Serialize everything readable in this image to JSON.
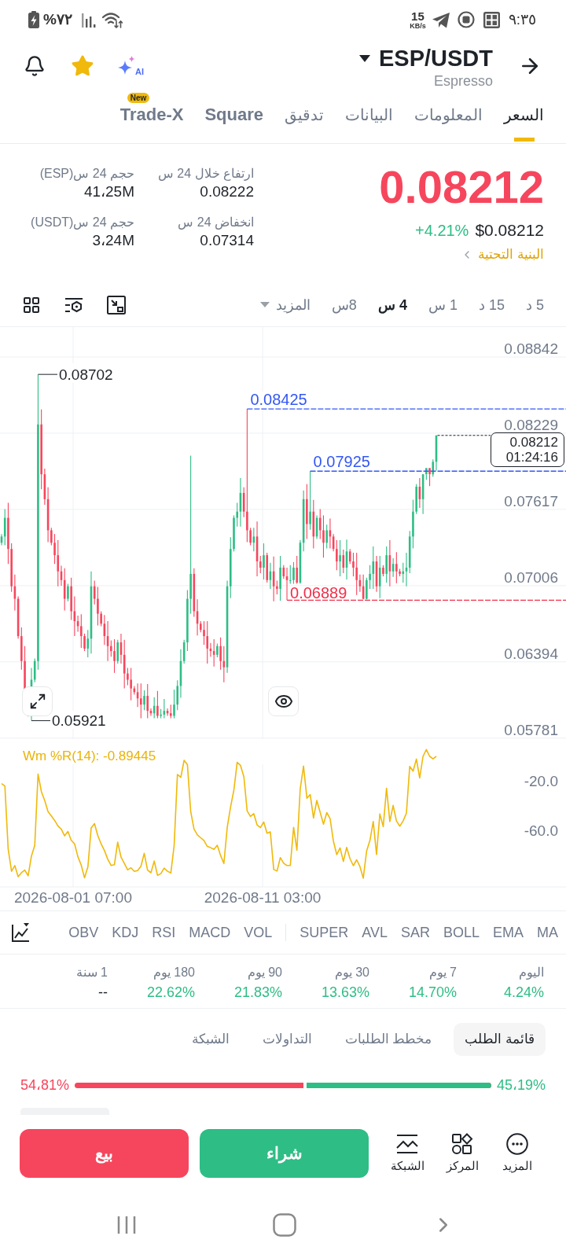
{
  "status_bar": {
    "time": "٩:٣٥",
    "network_speed": "15",
    "network_speed_unit": "KB/s",
    "battery": "%٧٢"
  },
  "header": {
    "pair": "ESP/USDT",
    "name": "Espresso",
    "favorite": true,
    "ai_label": "AI"
  },
  "tabs": [
    {
      "label": "السعر",
      "kind": "section",
      "selected": true
    },
    {
      "label": "المعلومات",
      "kind": "section",
      "selected": false
    },
    {
      "label": "البيانات",
      "kind": "section",
      "selected": false
    },
    {
      "label": "تدقيق",
      "kind": "section",
      "selected": false
    },
    {
      "label": "Square",
      "kind": "product",
      "selected": false
    },
    {
      "label": "Trade-X",
      "kind": "product",
      "selected": false,
      "badge": "New"
    }
  ],
  "price": {
    "last": "0.08212",
    "last_falling": true,
    "usd": "$0.08212",
    "change": "+4.21%",
    "change_rising": true,
    "category": "البنية التحتية"
  },
  "stats": [
    {
      "label": "ارتفاع خلال 24 س",
      "value": "0.08222"
    },
    {
      "label": "حجم 24 س(ESP)",
      "value": "41،25M"
    },
    {
      "label": "انخفاض 24 س",
      "value": "0.07314"
    },
    {
      "label": "حجم 24 س(USDT)",
      "value": "3،24M"
    }
  ],
  "timeframes": [
    {
      "label": "5 د",
      "selected": false
    },
    {
      "label": "15 د",
      "selected": false
    },
    {
      "label": "1 س",
      "selected": false
    },
    {
      "label": "4 س",
      "selected": true
    },
    {
      "label": "8س",
      "selected": false
    }
  ],
  "timeframe_more": "المزيد",
  "chart": {
    "price_axis": [
      "0.08842",
      "0.08229",
      "0.07617",
      "0.07006",
      "0.06394",
      "0.05781"
    ],
    "high_label": "0.08702",
    "low_label": "0.05921",
    "levels": [
      {
        "label": "0.08425",
        "color": "#3358f4"
      },
      {
        "label": "0.07925",
        "color": "#3358f4"
      },
      {
        "label": "0.06889",
        "color": "#f0304a"
      }
    ],
    "last_price": "0.08212",
    "countdown": "01:24:16"
  },
  "indicator": {
    "label": "Wm %R(14): -0.89445",
    "axis": [
      "-20.0",
      "-60.0"
    ],
    "dates": [
      "2026-08-11 03:00",
      "2026-08-01 07:00"
    ]
  },
  "indicator_tabs": {
    "main": [
      "MA",
      "EMA",
      "BOLL",
      "SAR",
      "AVL",
      "SUPER"
    ],
    "sub": [
      "VOL",
      "MACD",
      "RSI",
      "KDJ",
      "OBV"
    ]
  },
  "performance": [
    {
      "period": "اليوم",
      "value": "4.24%",
      "color": "#2ebd85"
    },
    {
      "period": "7 يوم",
      "value": "14.70%",
      "color": "#2ebd85"
    },
    {
      "period": "30 يوم",
      "value": "13.63%",
      "color": "#2ebd85"
    },
    {
      "period": "90 يوم",
      "value": "21.83%",
      "color": "#2ebd85"
    },
    {
      "period": "180 يوم",
      "value": "22.62%",
      "color": "#2ebd85"
    },
    {
      "period": "1 سنة",
      "value": "--",
      "color": "#1e2329"
    }
  ],
  "book_tabs": [
    {
      "label": "قائمة الطلب",
      "selected": true
    },
    {
      "label": "مخطط الطلبات",
      "selected": false
    },
    {
      "label": "التداولات",
      "selected": false
    },
    {
      "label": "الشبكة",
      "selected": false
    }
  ],
  "ratio": {
    "sell": "54،81%",
    "buy": "45،19%",
    "level": 0.4519
  },
  "actions": [
    {
      "label": "المزيد",
      "kind": "more"
    },
    {
      "label": "المركز",
      "kind": "position"
    },
    {
      "label": "الشبكة",
      "kind": "grid"
    }
  ],
  "trade_buttons": [
    {
      "label": "شراء",
      "kind": "buy"
    },
    {
      "label": "بيع",
      "kind": "sell"
    }
  ]
}
